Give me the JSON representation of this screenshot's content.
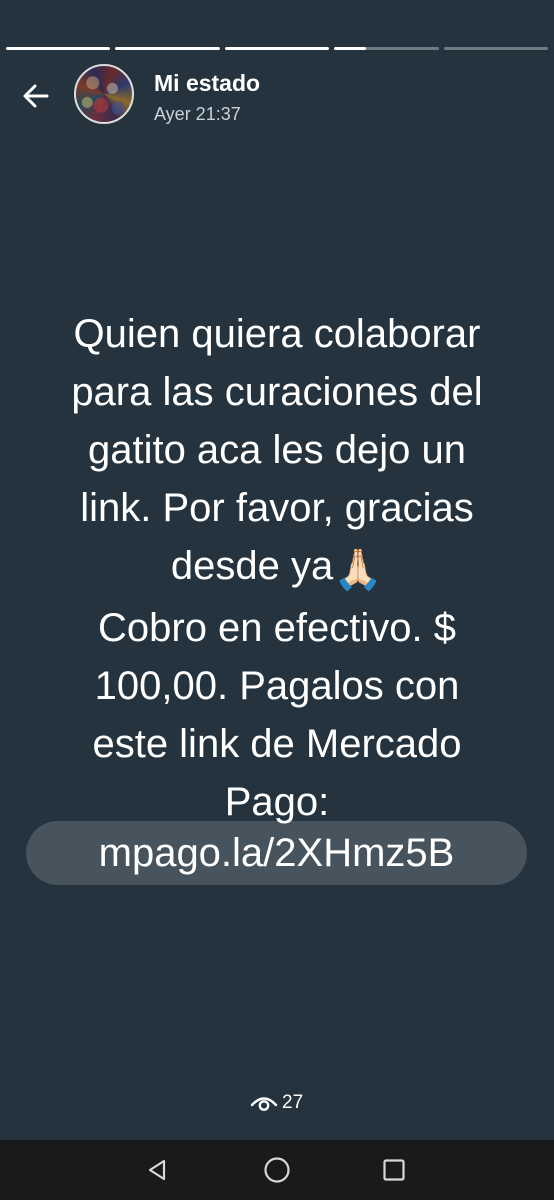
{
  "story": {
    "segments": [
      {
        "progress": 1.0
      },
      {
        "progress": 1.0
      },
      {
        "progress": 1.0
      },
      {
        "progress": 0.3
      },
      {
        "progress": 0.0
      }
    ]
  },
  "header": {
    "name": "Mi estado",
    "time": "Ayer 21:37",
    "back_icon": "arrow-left-icon",
    "avatar_icon": "profile-photo-collage"
  },
  "message": {
    "lines": [
      "Quien quiera colaborar",
      "para las curaciones del",
      "gatito aca les dejo un",
      "link. Por favor, gracias",
      "desde ya",
      "Cobro en efectivo. $",
      "100,00. Pagalos con",
      "este link de Mercado",
      "Pago:"
    ],
    "emoji": "🙏🏻",
    "link": "mpago.la/2XHmz5B"
  },
  "views": {
    "count": "27",
    "icon": "eye-icon"
  },
  "nav": {
    "back_icon": "triangle-back-icon",
    "home_icon": "circle-home-icon",
    "recents_icon": "square-recents-icon"
  },
  "colors": {
    "background": "#24333e",
    "navbar": "#191a1c",
    "text": "#ffffff",
    "subtext": "#c9d2d8"
  }
}
